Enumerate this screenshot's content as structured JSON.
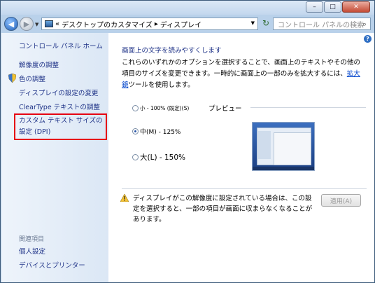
{
  "title_bar": {
    "minimize_label": "–",
    "maximize_label": "□",
    "close_label": "✕"
  },
  "nav": {
    "back_icon": "◀",
    "forward_icon": "▶",
    "path_prefix": "«",
    "breadcrumb": [
      "デスクトップのカスタマイズ",
      "ディスプレイ"
    ],
    "search_placeholder": "コントロール パネルの検索"
  },
  "sidebar": {
    "home": "コントロール パネル ホーム",
    "items": [
      {
        "label": "解像度の調整"
      },
      {
        "label": "色の調整"
      },
      {
        "label": "ディスプレイの設定の変更"
      },
      {
        "label": "ClearType テキストの調整"
      },
      {
        "label": "カスタム テキスト サイズの設定 (DPI)"
      }
    ],
    "see_also_title": "関連項目",
    "see_also": [
      "個人設定",
      "デバイスとプリンター"
    ]
  },
  "main": {
    "help_icon": "?",
    "heading": "画面上の文字を読みやすくします",
    "description_pre": "これらのいずれかのオプションを選択することで、画面上のテキストやその他の項目のサイズを変更できます。一時的に画面上の一部のみを拡大するには、",
    "description_link": "拡大鏡",
    "description_post": "ツールを使用します。",
    "options": [
      {
        "label": "小 - 100% (既定)(S)",
        "selected": false
      },
      {
        "label": "中(M) - 125%",
        "selected": true
      },
      {
        "label": "大(L) - 150%",
        "selected": false
      }
    ],
    "preview_label": "プレビュー",
    "warning_text": "ディスプレイがこの解像度に設定されている場合は、この設定を選択すると、一部の項目が画面に収まらなくなることがあります。",
    "apply_label": "適用(A)"
  },
  "colors": {
    "accent_link": "#1e3287",
    "highlight_border": "#e60012"
  }
}
